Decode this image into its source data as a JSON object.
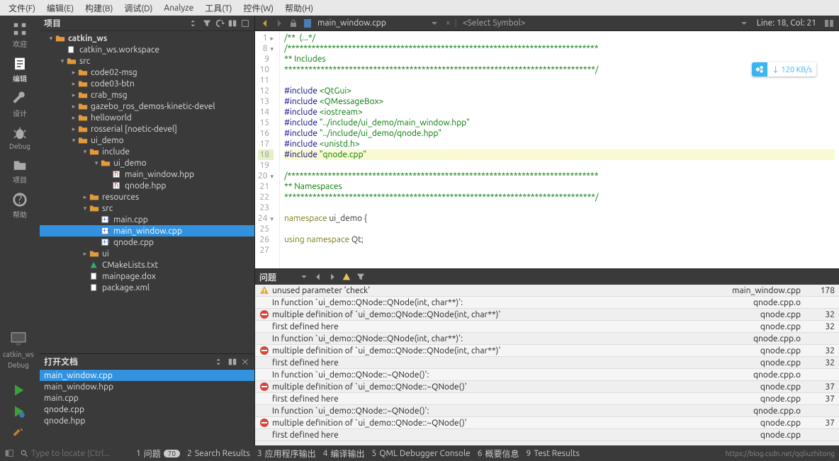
{
  "menubar": [
    "文件(F)",
    "编辑(E)",
    "构建(B)",
    "调试(D)",
    "Analyze",
    "工具(T)",
    "控件(W)",
    "帮助(H)"
  ],
  "leftbar": [
    {
      "icon": "grid",
      "label": "欢迎"
    },
    {
      "icon": "edit",
      "label": "编辑",
      "active": true
    },
    {
      "icon": "wrench",
      "label": "设计"
    },
    {
      "icon": "bug",
      "label": "Debug"
    },
    {
      "icon": "folder",
      "label": "项目"
    },
    {
      "icon": "help",
      "label": "帮助"
    }
  ],
  "project_panel_title": "项目",
  "tree": [
    {
      "depth": 0,
      "arrow": "▾",
      "icon": "folder",
      "name": "catkin_ws",
      "bold": true
    },
    {
      "depth": 1,
      "arrow": "",
      "icon": "file",
      "name": "catkin_ws.workspace"
    },
    {
      "depth": 1,
      "arrow": "▾",
      "icon": "folder",
      "name": "src"
    },
    {
      "depth": 2,
      "arrow": "▸",
      "icon": "folder",
      "name": "code02-msg"
    },
    {
      "depth": 2,
      "arrow": "▸",
      "icon": "folder",
      "name": "code03-btn"
    },
    {
      "depth": 2,
      "arrow": "▸",
      "icon": "folder",
      "name": "crab_msg"
    },
    {
      "depth": 2,
      "arrow": "▸",
      "icon": "folder",
      "name": "gazebo_ros_demos-kinetic-devel"
    },
    {
      "depth": 2,
      "arrow": "▸",
      "icon": "folder",
      "name": "helloworld"
    },
    {
      "depth": 2,
      "arrow": "▸",
      "icon": "folder",
      "name": "rosserial [noetic-devel]"
    },
    {
      "depth": 2,
      "arrow": "▾",
      "icon": "folder",
      "name": "ui_demo"
    },
    {
      "depth": 3,
      "arrow": "▾",
      "icon": "folder",
      "name": "include"
    },
    {
      "depth": 4,
      "arrow": "▾",
      "icon": "folder",
      "name": "ui_demo"
    },
    {
      "depth": 5,
      "arrow": "",
      "icon": "h",
      "name": "main_window.hpp"
    },
    {
      "depth": 5,
      "arrow": "",
      "icon": "h",
      "name": "qnode.hpp"
    },
    {
      "depth": 3,
      "arrow": "▸",
      "icon": "folder",
      "name": "resources"
    },
    {
      "depth": 3,
      "arrow": "▾",
      "icon": "folder",
      "name": "src"
    },
    {
      "depth": 4,
      "arrow": "",
      "icon": "cpp",
      "name": "main.cpp"
    },
    {
      "depth": 4,
      "arrow": "",
      "icon": "cpp",
      "name": "main_window.cpp",
      "selected": true
    },
    {
      "depth": 4,
      "arrow": "",
      "icon": "cpp",
      "name": "qnode.cpp"
    },
    {
      "depth": 3,
      "arrow": "▸",
      "icon": "folder",
      "name": "ui"
    },
    {
      "depth": 3,
      "arrow": "",
      "icon": "cmake",
      "name": "CMakeLists.txt"
    },
    {
      "depth": 3,
      "arrow": "",
      "icon": "file",
      "name": "mainpage.dox"
    },
    {
      "depth": 3,
      "arrow": "",
      "icon": "file",
      "name": "package.xml"
    }
  ],
  "open_docs_title": "打开文档",
  "open_docs": [
    {
      "name": "main_window.cpp",
      "selected": true
    },
    {
      "name": "main_window.hpp"
    },
    {
      "name": "main.cpp"
    },
    {
      "name": "qnode.cpp"
    },
    {
      "name": "qnode.hpp"
    }
  ],
  "context_project": "catkin_ws",
  "context_build": "Debug",
  "editor": {
    "filename": "main_window.cpp",
    "symbol": "<Select Symbol>",
    "linecol": "Line: 18, Col: 21",
    "lines": [
      {
        "n": 1,
        "fold": "▸",
        "html": "<span class='cmt'>/**  (...*/</span>"
      },
      {
        "n": 8,
        "fold": "▾",
        "html": "<span class='cmt'>/*****************************************************************************</span>"
      },
      {
        "n": 9,
        "fold": "",
        "html": "<span class='cmt'>** Includes</span>"
      },
      {
        "n": 10,
        "fold": "",
        "html": "<span class='cmt'>*****************************************************************************/</span>"
      },
      {
        "n": 11,
        "fold": "",
        "html": ""
      },
      {
        "n": 12,
        "fold": "",
        "html": "<span class='pp'>#include</span> <span class='str'>&lt;QtGui&gt;</span>"
      },
      {
        "n": 13,
        "fold": "",
        "html": "<span class='pp'>#include</span> <span class='str'>&lt;QMessageBox&gt;</span>"
      },
      {
        "n": 14,
        "fold": "",
        "html": "<span class='pp'>#include</span> <span class='str'>&lt;iostream&gt;</span>"
      },
      {
        "n": 15,
        "fold": "",
        "html": "<span class='pp'>#include</span> <span class='str'>\"../include/ui_demo/main_window.hpp\"</span>"
      },
      {
        "n": 16,
        "fold": "",
        "html": "<span class='pp'>#include</span> <span class='str'>\"../include/ui_demo/qnode.hpp\"</span>"
      },
      {
        "n": 17,
        "fold": "",
        "html": "<span class='pp'>#include</span> <span class='str'>&lt;unistd.h&gt;</span>"
      },
      {
        "n": 18,
        "fold": "",
        "html": "<span class='pp'>#include</span> <span class='str'>\"qnode.cpp\"</span>",
        "current": true
      },
      {
        "n": 19,
        "fold": "",
        "html": ""
      },
      {
        "n": 20,
        "fold": "▾",
        "html": "<span class='cmt'>/*****************************************************************************</span>"
      },
      {
        "n": 21,
        "fold": "",
        "html": "<span class='cmt'>** Namespaces</span>"
      },
      {
        "n": 22,
        "fold": "",
        "html": "<span class='cmt'>*****************************************************************************/</span>"
      },
      {
        "n": 23,
        "fold": "",
        "html": ""
      },
      {
        "n": 24,
        "fold": "▾",
        "html": "<span class='kw'>namespace</span> ui_demo {"
      },
      {
        "n": 25,
        "fold": "",
        "html": ""
      },
      {
        "n": 26,
        "fold": "",
        "html": "<span class='kw'>using</span> <span class='kw'>namespace</span> Qt;"
      },
      {
        "n": 27,
        "fold": "",
        "html": ""
      }
    ]
  },
  "problems_title": "问题",
  "problems": [
    {
      "icon": "warn",
      "msg": "unused parameter 'check'",
      "file": "main_window.cpp",
      "line": "178"
    },
    {
      "icon": "",
      "msg": "In function `ui_demo::QNode::QNode(int, char**)':",
      "file": "qnode.cpp.o",
      "line": ""
    },
    {
      "icon": "err",
      "msg": "multiple definition of `ui_demo::QNode::QNode(int, char**)'",
      "file": "qnode.cpp",
      "line": "32"
    },
    {
      "icon": "",
      "msg": "first defined here",
      "file": "qnode.cpp",
      "line": "32"
    },
    {
      "icon": "",
      "msg": "In function `ui_demo::QNode::QNode(int, char**)':",
      "file": "qnode.cpp.o",
      "line": ""
    },
    {
      "icon": "err",
      "msg": "multiple definition of `ui_demo::QNode::QNode(int, char**)'",
      "file": "qnode.cpp",
      "line": "32"
    },
    {
      "icon": "",
      "msg": "first defined here",
      "file": "qnode.cpp",
      "line": "32"
    },
    {
      "icon": "",
      "msg": "In function `ui_demo::QNode::~QNode()':",
      "file": "qnode.cpp.o",
      "line": ""
    },
    {
      "icon": "err",
      "msg": "multiple definition of `ui_demo::QNode::~QNode()'",
      "file": "qnode.cpp",
      "line": "37"
    },
    {
      "icon": "",
      "msg": "first defined here",
      "file": "qnode.cpp",
      "line": "37"
    },
    {
      "icon": "",
      "msg": "In function `ui_demo::QNode::~QNode()':",
      "file": "qnode.cpp.o",
      "line": ""
    },
    {
      "icon": "err",
      "msg": "multiple definition of `ui_demo::QNode::~QNode()'",
      "file": "qnode.cpp",
      "line": "37"
    },
    {
      "icon": "",
      "msg": "first defined here",
      "file": "qnode.cpp",
      "line": ""
    }
  ],
  "statusbar": {
    "locate_placeholder": "Type to locate (Ctrl...",
    "items": [
      {
        "n": "1",
        "label": "问题",
        "badge": "70"
      },
      {
        "n": "2",
        "label": "Search Results"
      },
      {
        "n": "3",
        "label": "应用程序输出"
      },
      {
        "n": "4",
        "label": "编译输出"
      },
      {
        "n": "5",
        "label": "QML Debugger Console"
      },
      {
        "n": "6",
        "label": "概要信息"
      },
      {
        "n": "9",
        "label": "Test Results"
      }
    ],
    "watermark": "https://blog.csdn.net/qqliuzhitong"
  },
  "float_badge": "↓ 120 KB/s"
}
